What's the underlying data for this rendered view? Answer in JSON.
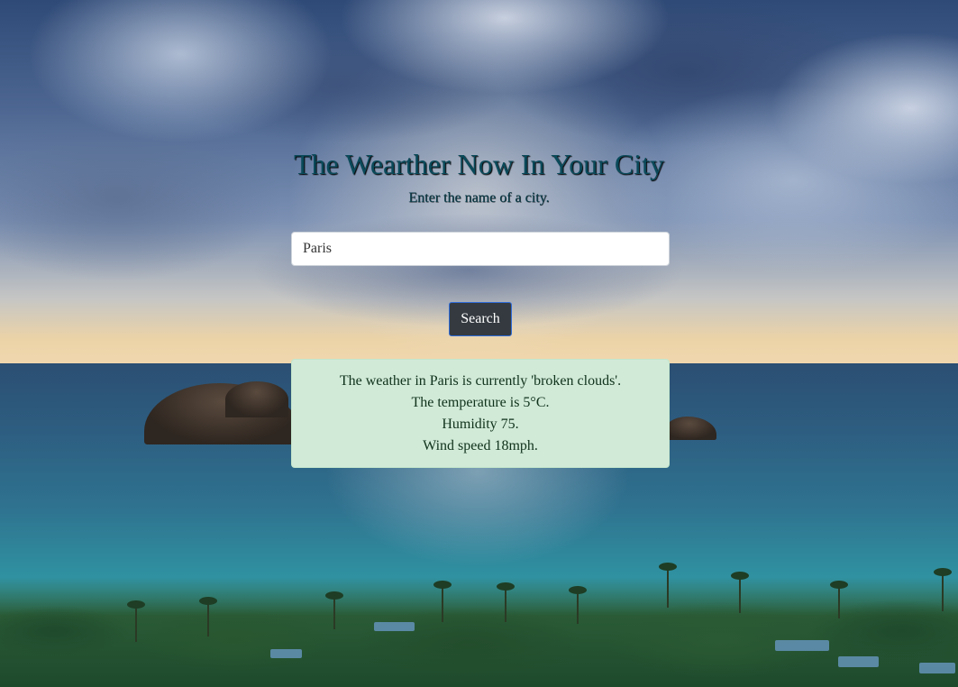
{
  "page": {
    "title": "The Wearther Now In Your City",
    "subtitle": "Enter the name of a city."
  },
  "search": {
    "value": "Paris",
    "button_label": "Search"
  },
  "result": {
    "lines": [
      "The weather in Paris is currently 'broken clouds'.",
      "The temperature is 5°C.",
      "Humidity 75.",
      "Wind speed 18mph."
    ]
  },
  "colors": {
    "title": "#0a4a5a",
    "button_bg": "#343a40",
    "button_border": "#2f6bd8",
    "result_bg": "#d1ead8"
  }
}
